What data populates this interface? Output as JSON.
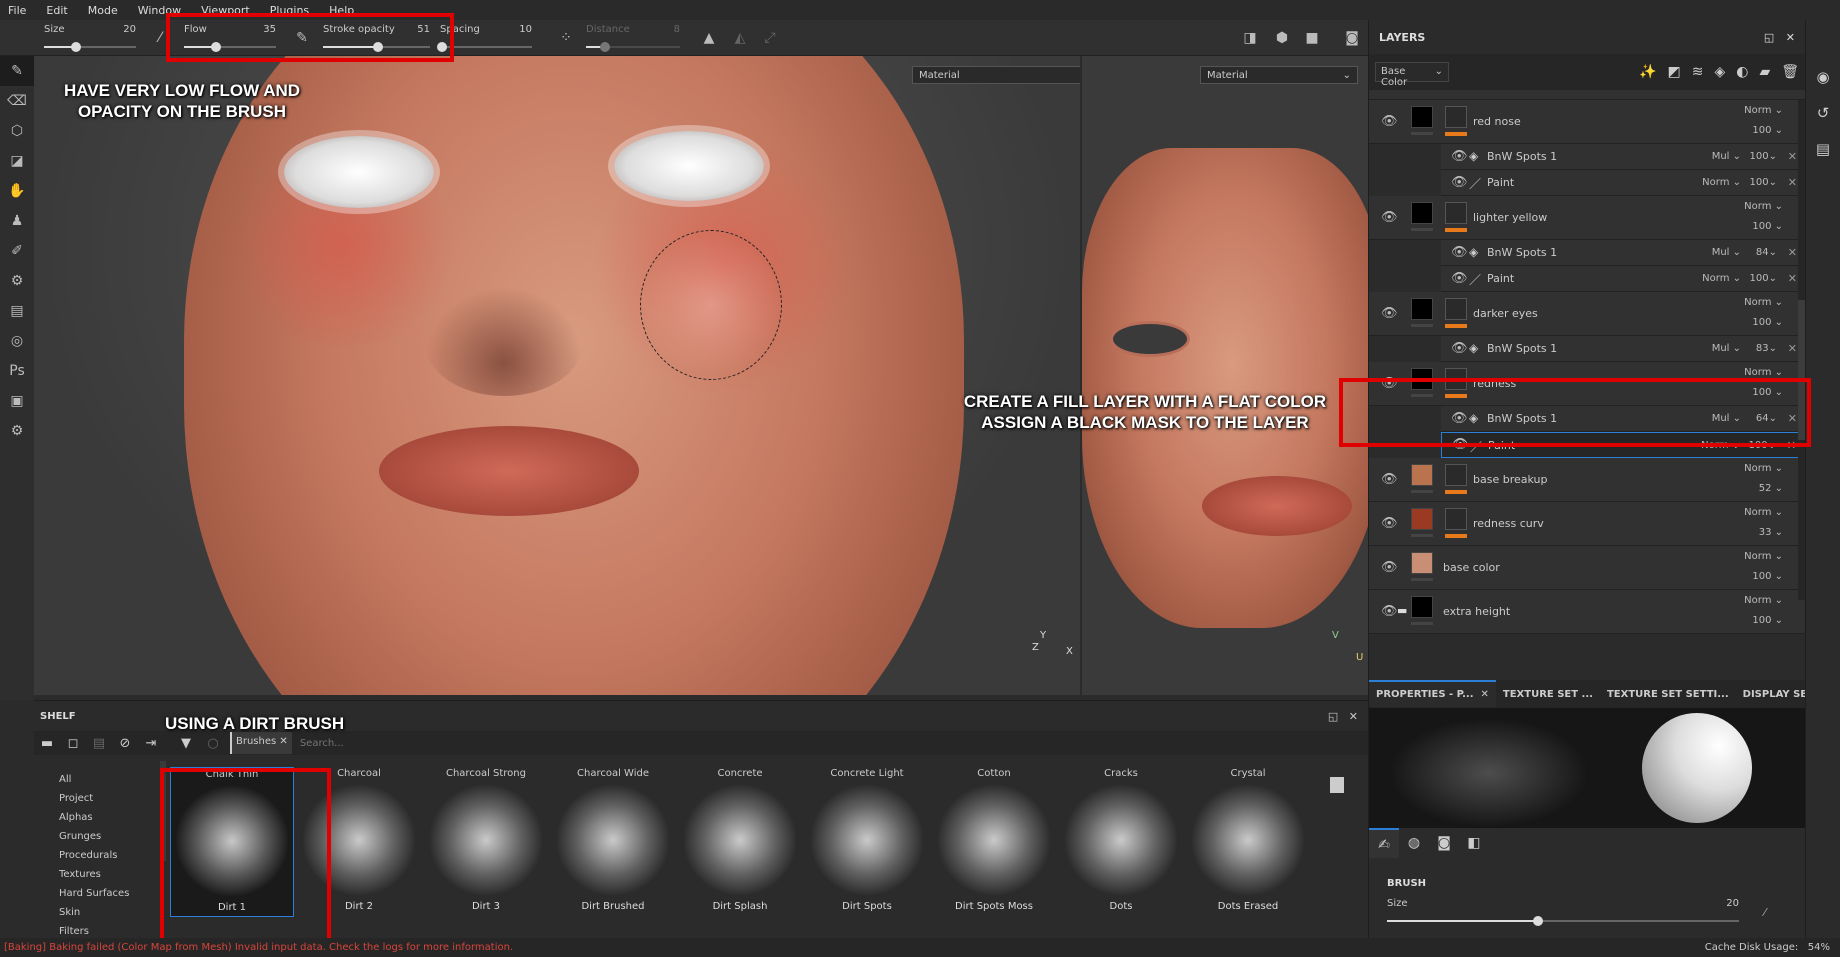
{
  "menu": [
    "File",
    "Edit",
    "Mode",
    "Window",
    "Viewport",
    "Plugins",
    "Help"
  ],
  "toolbar": {
    "size": {
      "label": "Size",
      "value": "20",
      "level": 0.35
    },
    "flow": {
      "label": "Flow",
      "value": "35",
      "level": 0.35
    },
    "stroke_opacity": {
      "label": "Stroke opacity",
      "value": "51",
      "level": 0.51
    },
    "spacing": {
      "label": "Spacing",
      "value": "10",
      "level": 0.02
    },
    "distance": {
      "label": "Distance",
      "value": "8",
      "level": 0.2
    }
  },
  "viewport": {
    "material_3d": "Material",
    "material_2d": "Material",
    "axis_x": "X",
    "axis_y": "Y",
    "axis_z": "Z",
    "axis_u": "U",
    "axis_v": "V"
  },
  "annotations": {
    "toolbar_note": [
      "HAVE VERY LOW FLOW AND",
      "OPACITY ON THE BRUSH"
    ],
    "layer_note": [
      "CREATE A FILL LAYER WITH A FLAT COLOR",
      "ASSIGN A BLACK MASK TO THE LAYER"
    ],
    "shelf_note": "USING A DIRT BRUSH"
  },
  "layers": {
    "title": "LAYERS",
    "channel": "Base Color",
    "rows": [
      {
        "type": "main",
        "name": "red nose",
        "blend": "Norm",
        "opacity": "100",
        "color": "#000000",
        "mask": true
      },
      {
        "type": "sub",
        "icon": "fill",
        "name": "BnW Spots 1",
        "blend": "Mul",
        "opacity": "100"
      },
      {
        "type": "sub",
        "icon": "paint",
        "name": "Paint",
        "blend": "Norm",
        "opacity": "100"
      },
      {
        "type": "main",
        "name": "lighter yellow",
        "blend": "Norm",
        "opacity": "100",
        "color": "#000000",
        "mask": true
      },
      {
        "type": "sub",
        "icon": "fill",
        "name": "BnW Spots 1",
        "blend": "Mul",
        "opacity": "84"
      },
      {
        "type": "sub",
        "icon": "paint",
        "name": "Paint",
        "blend": "Norm",
        "opacity": "100"
      },
      {
        "type": "main",
        "name": "darker eyes",
        "blend": "Norm",
        "opacity": "100",
        "color": "#000000",
        "mask": true
      },
      {
        "type": "sub",
        "icon": "fill",
        "name": "BnW Spots 1",
        "blend": "Mul",
        "opacity": "83"
      },
      {
        "type": "main",
        "name": "redness",
        "blend": "Norm",
        "opacity": "100",
        "color": "#000000",
        "mask": true
      },
      {
        "type": "sub",
        "icon": "fill",
        "name": "BnW Spots 1",
        "blend": "Mul",
        "opacity": "64"
      },
      {
        "type": "sub",
        "icon": "paint",
        "name": "Paint",
        "blend": "Norm",
        "opacity": "100",
        "selected": true
      },
      {
        "type": "main",
        "name": "base breakup",
        "blend": "Norm",
        "opacity": "52",
        "color": "#b9734f",
        "mask": true
      },
      {
        "type": "main",
        "name": "redness curv",
        "blend": "Norm",
        "opacity": "33",
        "color": "#9a3a22",
        "mask": true
      },
      {
        "type": "main",
        "name": "base color",
        "blend": "Norm",
        "opacity": "100",
        "color": "#c98f74",
        "mask": false
      },
      {
        "type": "main",
        "name": "extra height",
        "blend": "Norm",
        "opacity": "100",
        "color": "#000000",
        "mask": false,
        "folder": true
      }
    ]
  },
  "shelf": {
    "title": "SHELF",
    "filter_tag": "Brushes",
    "search_placeholder": "Search...",
    "categories": [
      "All",
      "Project",
      "Alphas",
      "Grunges",
      "Procedurals",
      "Textures",
      "Hard Surfaces",
      "Skin",
      "Filters"
    ],
    "top_labels": [
      "Chalk Thin",
      "Charcoal",
      "Charcoal Strong",
      "Charcoal Wide",
      "Concrete",
      "Concrete Light",
      "Cotton",
      "Cracks",
      "Crystal"
    ],
    "brushes": [
      "Dirt 1",
      "Dirt 2",
      "Dirt 3",
      "Dirt Brushed",
      "Dirt Splash",
      "Dirt Spots",
      "Dirt Spots Moss",
      "Dots",
      "Dots Erased"
    ],
    "selected": "Dirt 1"
  },
  "properties": {
    "tabs": [
      "PROPERTIES - P...",
      "TEXTURE SET ...",
      "TEXTURE SET SETTI...",
      "DISPLAY SETTI..."
    ],
    "section": "BRUSH",
    "size_label": "Size",
    "size_value": "20",
    "size_level": 0.43
  },
  "status": {
    "error": "[Baking] Baking failed (Color Map from Mesh) Invalid input data. Check the logs for more information.",
    "cache_label": "Cache Disk Usage:",
    "cache_value": "54%"
  },
  "colors": {
    "accent": "#2c7fd6",
    "annotation_box": "#e00000",
    "layer_color_bar": "#e87a1c",
    "error_text": "#d9453a"
  }
}
